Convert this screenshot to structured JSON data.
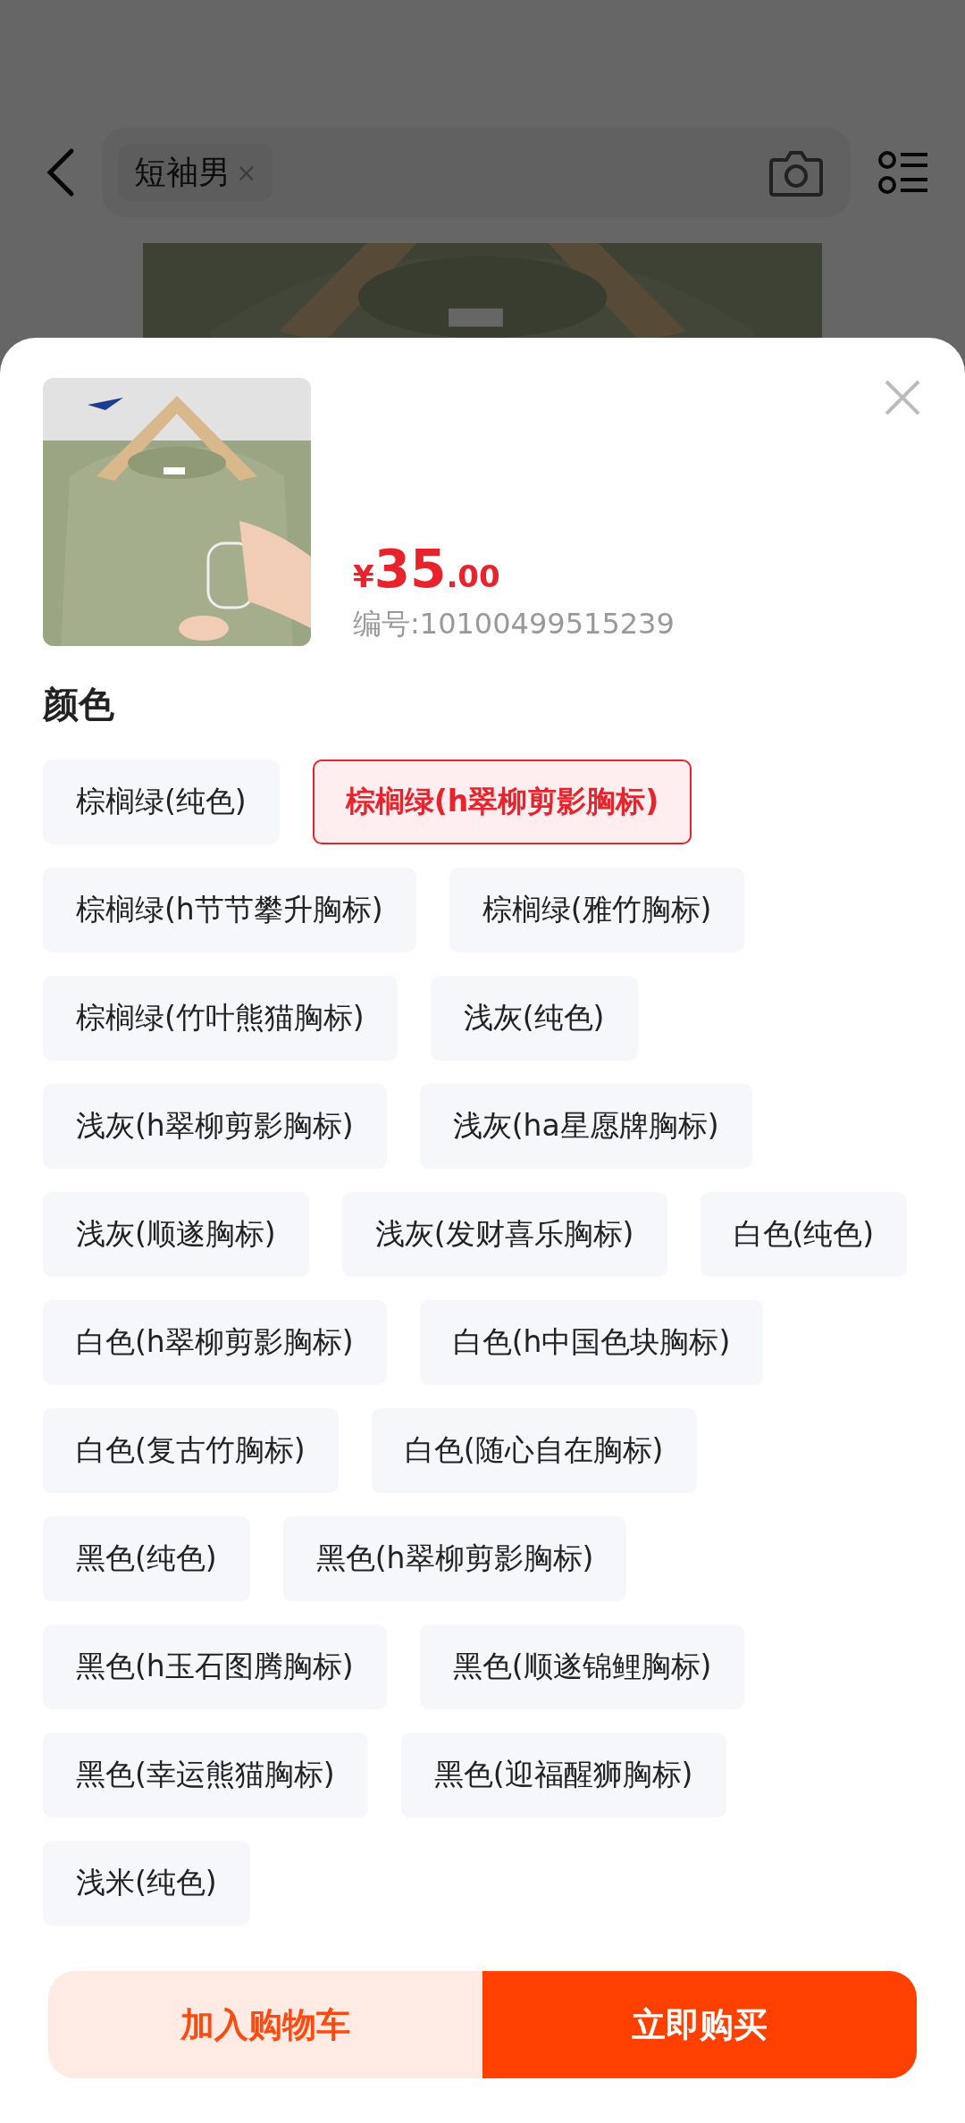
{
  "search": {
    "tag": "短袖男",
    "tag_remove": "×"
  },
  "product": {
    "currency": "¥",
    "price_integer": "35",
    "price_decimal": ".00",
    "code": "编号:10100499515239"
  },
  "section_title": "颜色",
  "options": [
    {
      "label": "棕榈绿(纯色)",
      "selected": false
    },
    {
      "label": "棕榈绿(h翠柳剪影胸标)",
      "selected": true
    },
    {
      "label": "棕榈绿(h节节攀升胸标)",
      "selected": false
    },
    {
      "label": "棕榈绿(雅竹胸标)",
      "selected": false
    },
    {
      "label": "棕榈绿(竹叶熊猫胸标)",
      "selected": false
    },
    {
      "label": "浅灰(纯色)",
      "selected": false
    },
    {
      "label": "浅灰(h翠柳剪影胸标)",
      "selected": false
    },
    {
      "label": "浅灰(ha星愿牌胸标)",
      "selected": false
    },
    {
      "label": "浅灰(顺遂胸标)",
      "selected": false
    },
    {
      "label": "浅灰(发财喜乐胸标)",
      "selected": false
    },
    {
      "label": "白色(纯色)",
      "selected": false
    },
    {
      "label": "白色(h翠柳剪影胸标)",
      "selected": false
    },
    {
      "label": "白色(h中国色块胸标)",
      "selected": false
    },
    {
      "label": "白色(复古竹胸标)",
      "selected": false
    },
    {
      "label": "白色(随心自在胸标)",
      "selected": false
    },
    {
      "label": "黑色(纯色)",
      "selected": false
    },
    {
      "label": "黑色(h翠柳剪影胸标)",
      "selected": false
    },
    {
      "label": "黑色(h玉石图腾胸标)",
      "selected": false
    },
    {
      "label": "黑色(顺遂锦鲤胸标)",
      "selected": false
    },
    {
      "label": "黑色(幸运熊猫胸标)",
      "selected": false
    },
    {
      "label": "黑色(迎福醒狮胸标)",
      "selected": false
    },
    {
      "label": "浅米(纯色)",
      "selected": false
    }
  ],
  "buttons": [
    {
      "label": "加入购物车",
      "kind": "cart"
    },
    {
      "label": "立即购买",
      "kind": "buy"
    }
  ]
}
